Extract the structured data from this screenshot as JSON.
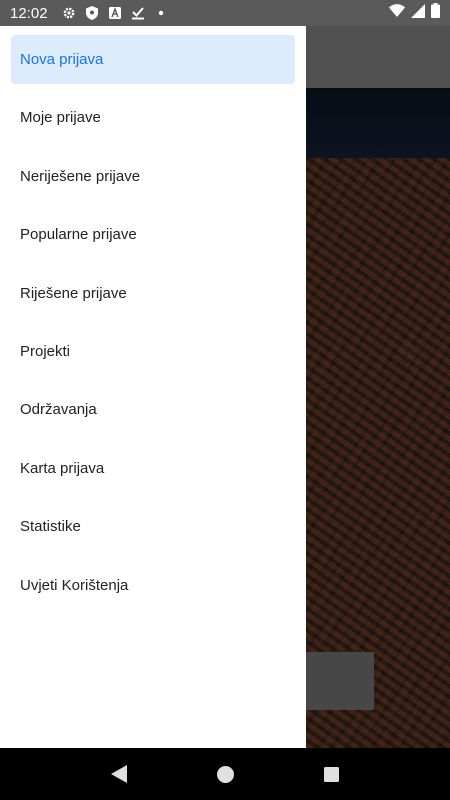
{
  "status_bar": {
    "time": "12:02",
    "left_icons": [
      "settings-icon",
      "shield-icon",
      "a-box-icon",
      "download-check-icon",
      "dot-icon"
    ],
    "right_icons": [
      "wifi-icon",
      "signal-icon",
      "battery-icon"
    ]
  },
  "drawer": {
    "items": [
      {
        "label": "Nova prijava",
        "active": true
      },
      {
        "label": "Moje prijave"
      },
      {
        "label": "Neriješene prijave"
      },
      {
        "label": "Popularne prijave"
      },
      {
        "label": "Riješene prijave"
      },
      {
        "label": "Projekti"
      },
      {
        "label": "Održavanja"
      },
      {
        "label": "Karta prijava"
      },
      {
        "label": "Statistike"
      },
      {
        "label": "Uvjeti Korištenja"
      }
    ]
  },
  "colors": {
    "active_bg": "#dcecfc",
    "active_text": "#1a73e8",
    "text": "#222222"
  },
  "nav_bar": {
    "buttons": [
      "back-icon",
      "home-icon",
      "recents-icon"
    ]
  }
}
